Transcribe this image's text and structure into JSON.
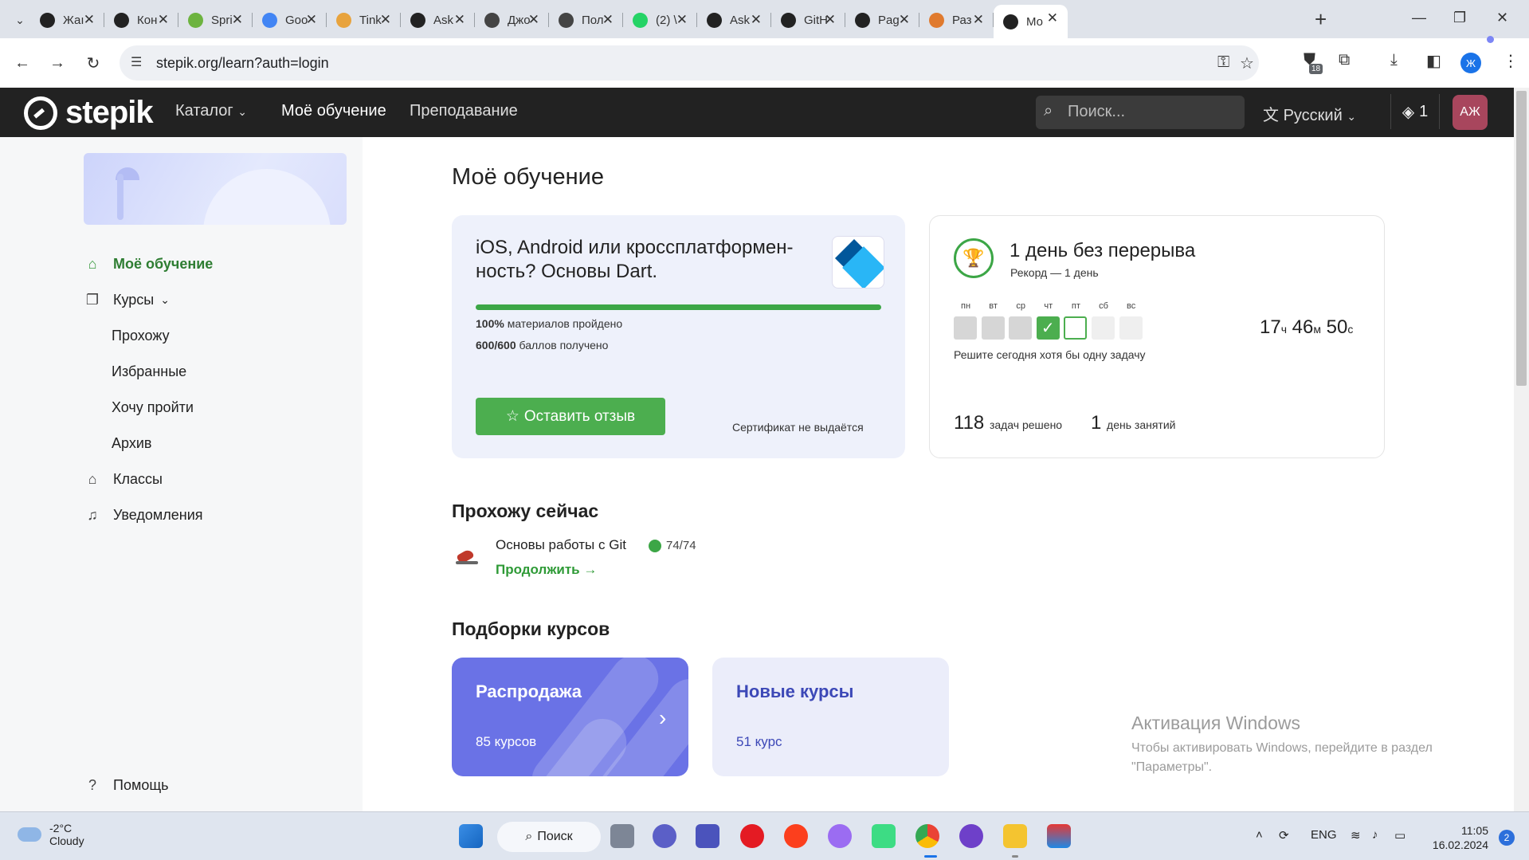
{
  "browser": {
    "tabs": [
      {
        "label": "Жаı",
        "favicon": "stepik-icon",
        "color": "#222222"
      },
      {
        "label": "Кон",
        "favicon": "stepik-icon",
        "color": "#222222"
      },
      {
        "label": "Spri",
        "favicon": "spring-icon",
        "color": "#6db33f"
      },
      {
        "label": "Goo",
        "favicon": "google-icon",
        "color": "#4285f4"
      },
      {
        "label": "Tink",
        "favicon": "grid-icon",
        "color": "#e8a33d"
      },
      {
        "label": "Ask",
        "favicon": "github-icon",
        "color": "#222222"
      },
      {
        "label": "Джо",
        "favicon": "page-icon",
        "color": "#444444"
      },
      {
        "label": "Пол",
        "favicon": "page-icon",
        "color": "#444444"
      },
      {
        "label": "(2) \\",
        "favicon": "whatsapp-icon",
        "color": "#25d366"
      },
      {
        "label": "Ask",
        "favicon": "github-icon",
        "color": "#222222"
      },
      {
        "label": "GitH",
        "favicon": "github-icon",
        "color": "#222222"
      },
      {
        "label": "Pag",
        "favicon": "github-icon",
        "color": "#222222"
      },
      {
        "label": "Раз",
        "favicon": "habr-icon",
        "color": "#e07a2e"
      },
      {
        "label": "Мо",
        "favicon": "stepik-icon",
        "color": "#222222",
        "active": true
      }
    ],
    "url": "stepik.org/learn?auth=login",
    "extension_badge": "18",
    "profile_letter": "Ж"
  },
  "header": {
    "logo_text": "stepik",
    "nav": {
      "catalog": "Каталог",
      "my_learning": "Моё обучение",
      "teaching": "Преподавание"
    },
    "search_placeholder": "Поиск...",
    "language": "Русский",
    "badge_count": "1",
    "avatar_initials": "АЖ"
  },
  "sidebar": {
    "my_learning": "Моё обучение",
    "courses": "Курсы",
    "sub": {
      "in_progress": "Прохожу",
      "favorites": "Избранные",
      "wishlist": "Хочу пройти",
      "archive": "Архив"
    },
    "classes": "Классы",
    "notifications": "Уведомления",
    "help": "Помощь"
  },
  "main": {
    "title": "Моё обучение",
    "course_card": {
      "title": "iOS, Android или кроссплатформен-ность? Основы Dart.",
      "progress_fraction": 1.0,
      "materials_pct": "100%",
      "materials_text": "материалов пройдено",
      "points": "600/600",
      "points_text": "баллов получено",
      "review_button": "Оставить отзыв",
      "certificate_note": "Сертификат не выдаётся"
    },
    "streak": {
      "title": "1 день без перерыва",
      "record": "Рекорд — 1 день",
      "days": [
        "пн",
        "вт",
        "ср",
        "чт",
        "пт",
        "сб",
        "вс"
      ],
      "day_states": [
        "missed",
        "missed",
        "missed",
        "done",
        "today",
        "future",
        "future"
      ],
      "hint": "Решите сегодня хотя бы одну задачу",
      "timer": {
        "h": "17",
        "h_unit": "ч",
        "m": "46",
        "m_unit": "м",
        "s": "50",
        "s_unit": "с"
      },
      "tasks_count": "118",
      "tasks_text": "задач решено",
      "days_count": "1",
      "days_text": "день занятий"
    },
    "now_section": {
      "title": "Прохожу сейчас",
      "course": "Основы работы с Git",
      "progress": "74/74",
      "continue": "Продолжить →"
    },
    "collections": {
      "title": "Подборки курсов",
      "items": [
        {
          "title": "Распродажа",
          "count": "85 курсов"
        },
        {
          "title": "Новые курсы",
          "count": "51 курс"
        }
      ]
    }
  },
  "windows_activation": {
    "title": "Активация Windows",
    "text": "Чтобы активировать Windows, перейдите в раздел \"Параметры\"."
  },
  "taskbar": {
    "weather_temp": "-2°C",
    "weather_desc": "Cloudy",
    "search": "Поиск",
    "lang": "ENG",
    "time": "11:05",
    "date": "16.02.2024",
    "notifications": "2"
  }
}
